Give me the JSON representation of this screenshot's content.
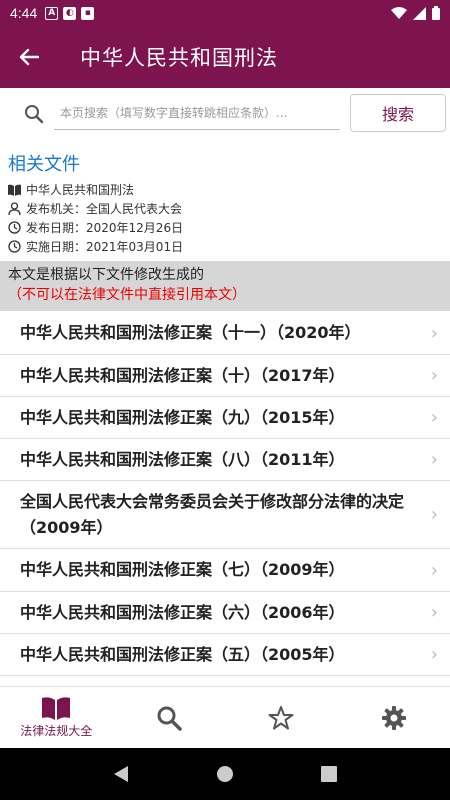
{
  "status_bar": {
    "time": "4:44"
  },
  "app_bar": {
    "title": "中华人民共和国刑法"
  },
  "search": {
    "placeholder": "本页搜索（填写数字直接转跳相应条款）...",
    "button_label": "搜索"
  },
  "related": {
    "heading": "相关文件",
    "doc_title": "中华人民共和国刑法",
    "issuer": "发布机关：全国人民代表大会",
    "publish_date": "发布日期：2020年12月26日",
    "effective_date": "实施日期：2021年03月01日"
  },
  "notice": {
    "main": "本文是根据以下文件修改生成的",
    "warning": "（不可以在法律文件中直接引用本文）"
  },
  "amendments": [
    "中华人民共和国刑法修正案（十一）（2020年）",
    "中华人民共和国刑法修正案（十）（2017年）",
    "中华人民共和国刑法修正案（九）（2015年）",
    "中华人民共和国刑法修正案（八）（2011年）",
    "全国人民代表大会常务委员会关于修改部分法律的决定（2009年）",
    "中华人民共和国刑法修正案（七）（2009年）",
    "中华人民共和国刑法修正案（六）（2006年）",
    "中华人民共和国刑法修正案（五）（2005年）"
  ],
  "bottom_nav": {
    "home_label": "法律法规大全"
  },
  "colors": {
    "primary": "#7d1450",
    "link": "#1976d2",
    "warning": "#ee0000"
  }
}
